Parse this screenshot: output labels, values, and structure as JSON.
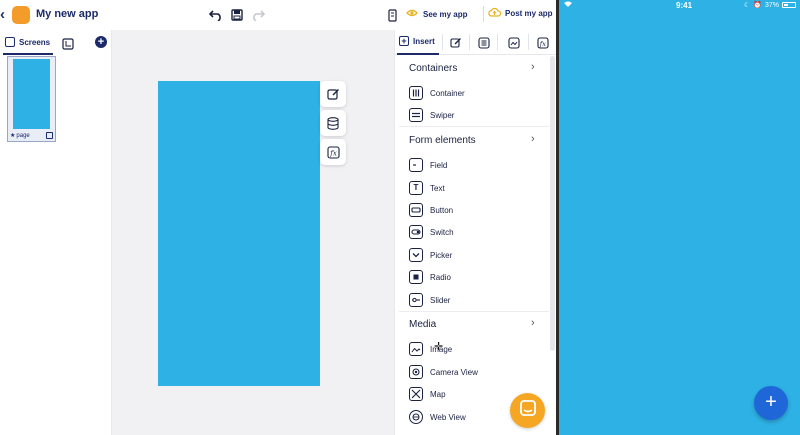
{
  "header": {
    "back_icon": "chevron-left-icon",
    "app_name": "My new app",
    "app_icon_color": "#f39c2c",
    "undo_icon": "undo-icon",
    "save_icon": "save-icon",
    "redo_icon": "redo-icon",
    "device_icon": "phone-icon",
    "see_label": "See my app",
    "post_label": "Post my app"
  },
  "screens_panel": {
    "tab_label": "Screens",
    "add_icon": "plus-circle-icon",
    "thumbnail": {
      "label": "page",
      "star_icon": "star-icon"
    }
  },
  "canvas": {
    "background": "#f1f1f3",
    "phone_color": "#2eb2e6",
    "tools": [
      "edit-icon",
      "database-icon",
      "function-icon"
    ]
  },
  "insert_panel": {
    "tab_label": "Insert",
    "tab_icons": [
      "edit-icon",
      "list-icon",
      "image-icon",
      "function-icon"
    ],
    "categories": [
      {
        "title": "Containers",
        "items": [
          {
            "label": "Container"
          },
          {
            "label": "Swiper"
          }
        ]
      },
      {
        "title": "Form elements",
        "items": [
          {
            "label": "Field"
          },
          {
            "label": "Text"
          },
          {
            "label": "Button"
          },
          {
            "label": "Switch"
          },
          {
            "label": "Picker"
          },
          {
            "label": "Radio"
          },
          {
            "label": "Slider"
          }
        ]
      },
      {
        "title": "Media",
        "items": [
          {
            "label": "Image"
          },
          {
            "label": "Camera View"
          },
          {
            "label": "Map"
          },
          {
            "label": "Web View"
          }
        ]
      }
    ]
  },
  "chat_fab_color": "#f5a623",
  "preview": {
    "background": "#2eb2e6",
    "time": "9:41",
    "battery": "37%",
    "fab_label": "+",
    "fab_color": "#1f66d8"
  }
}
